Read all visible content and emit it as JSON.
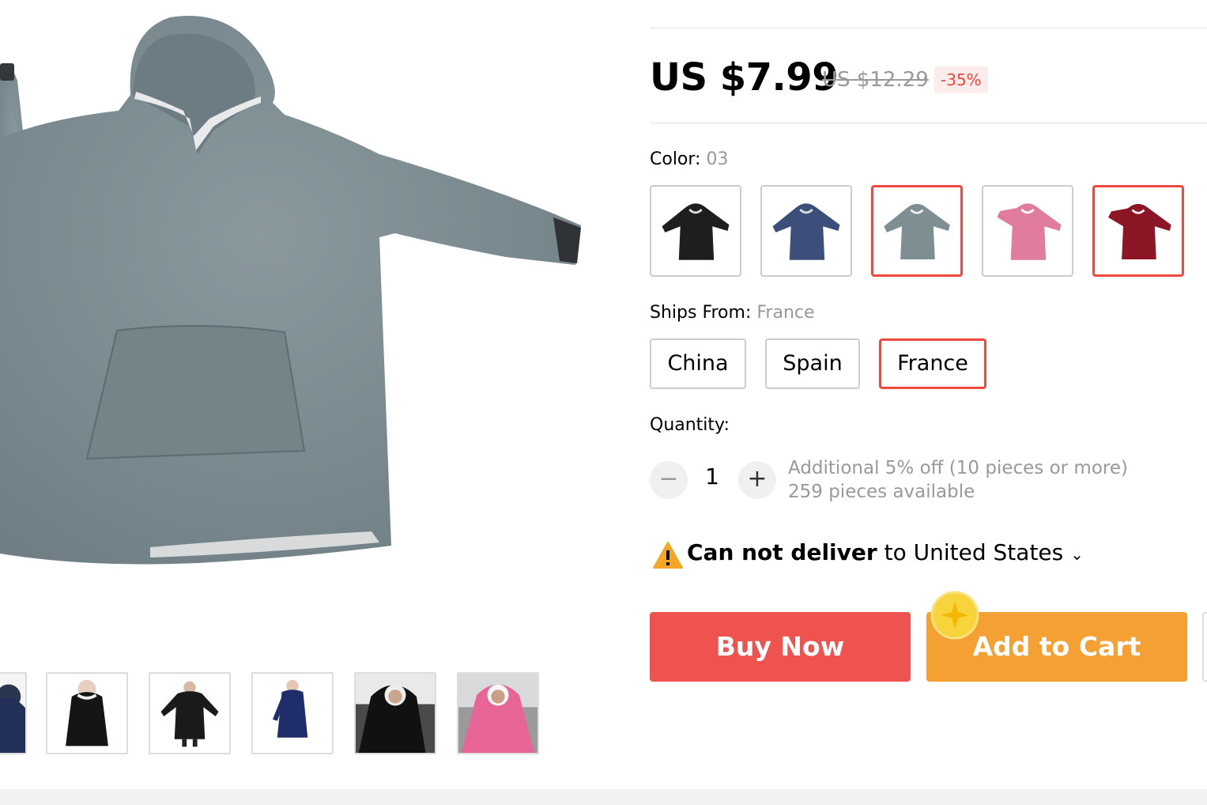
{
  "price": {
    "current": "US $7.99",
    "original": "US $12.29",
    "discount": "-35%"
  },
  "color": {
    "label": "Color: ",
    "selected_value": "03",
    "options": [
      {
        "name": "black",
        "hex": "#1d1e1f"
      },
      {
        "name": "navy",
        "hex": "#3b4f7a"
      },
      {
        "name": "gray",
        "hex": "#7e8e93"
      },
      {
        "name": "pink",
        "hex": "#e07c9d"
      },
      {
        "name": "burgundy",
        "hex": "#8c1626"
      }
    ]
  },
  "ships_from": {
    "label": "Ships From: ",
    "selected_value": "France",
    "options": [
      "China",
      "Spain",
      "France"
    ]
  },
  "quantity": {
    "label": "Quantity:",
    "value": "1",
    "minus": "−",
    "plus": "+",
    "bulk_note": "Additional 5% off (10 pieces or more)",
    "available": "259 pieces available"
  },
  "delivery": {
    "status": "Can not deliver",
    "destination": "to United States",
    "chevron": "⌄"
  },
  "actions": {
    "buy_now": "Buy Now",
    "add_to_cart": "Add to Cart"
  },
  "colors": {
    "accent": "#ef4a40",
    "buy": "#ef5350",
    "cart": "#f5a033",
    "product_gray": "#7e8e93"
  }
}
